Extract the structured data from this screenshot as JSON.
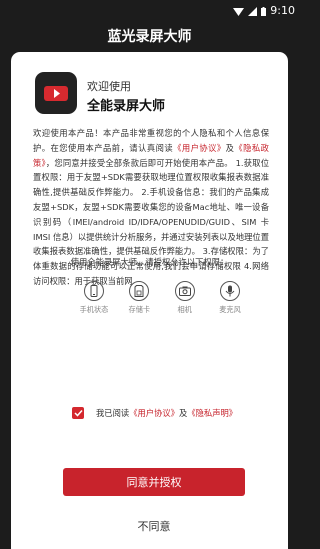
{
  "status_bar": {
    "time": "9:10"
  },
  "header": {
    "title": "蓝光录屏大师"
  },
  "dialog": {
    "welcome": "欢迎使用",
    "app_name": "全能录屏大师",
    "body": {
      "intro": "欢迎使用本产品！本产品非常重视您的个人隐私和个人信息保护。在您使用本产品前，请认真阅读",
      "user_agreement_link": "《用户协议》",
      "and": "及",
      "privacy_policy_link": "《隐私政策》",
      "rest": "，您同意并接受全部条款后即可开始使用本产品。 1.获取位置权限：用于友盟+SDK需要获取地理位置权限收集报表数据准确性,提供基础反作弊能力。 2.手机设备信息：我们的产品集成友盟+SDK，友盟+SDK需要收集您的设备Mac地址、唯一设备识别码（IMEI/android ID/IDFA/OPENUDID/GUID、SIM 卡 IMSI 信息）以提供统计分析服务，并通过安装列表以及地理位置收集报表数据准确性，提供基础反作弊能力。 3.存储权限：为了体重数据的存储功能可以正常使用,我们会申请存储权限 4.网络访问权限：用于获取当前网"
    },
    "permissions_intro": "使用全能录屏大师，请授权允许以下权限：",
    "permissions": [
      {
        "icon": "phone-icon",
        "label": "手机状态"
      },
      {
        "icon": "storage-icon",
        "label": "存储卡"
      },
      {
        "icon": "camera-icon",
        "label": "相机"
      },
      {
        "icon": "microphone-icon",
        "label": "麦克风"
      }
    ],
    "consent": {
      "prefix": "我已阅读",
      "user_agreement_link": "《用户协议》",
      "and": "及",
      "privacy_statement_link": "《隐私声明》"
    },
    "agree_button": "同意并授权",
    "disagree_button": "不同意"
  },
  "colors": {
    "accent": "#c8232c",
    "background": "#1c1c1c",
    "card": "#ffffff"
  }
}
